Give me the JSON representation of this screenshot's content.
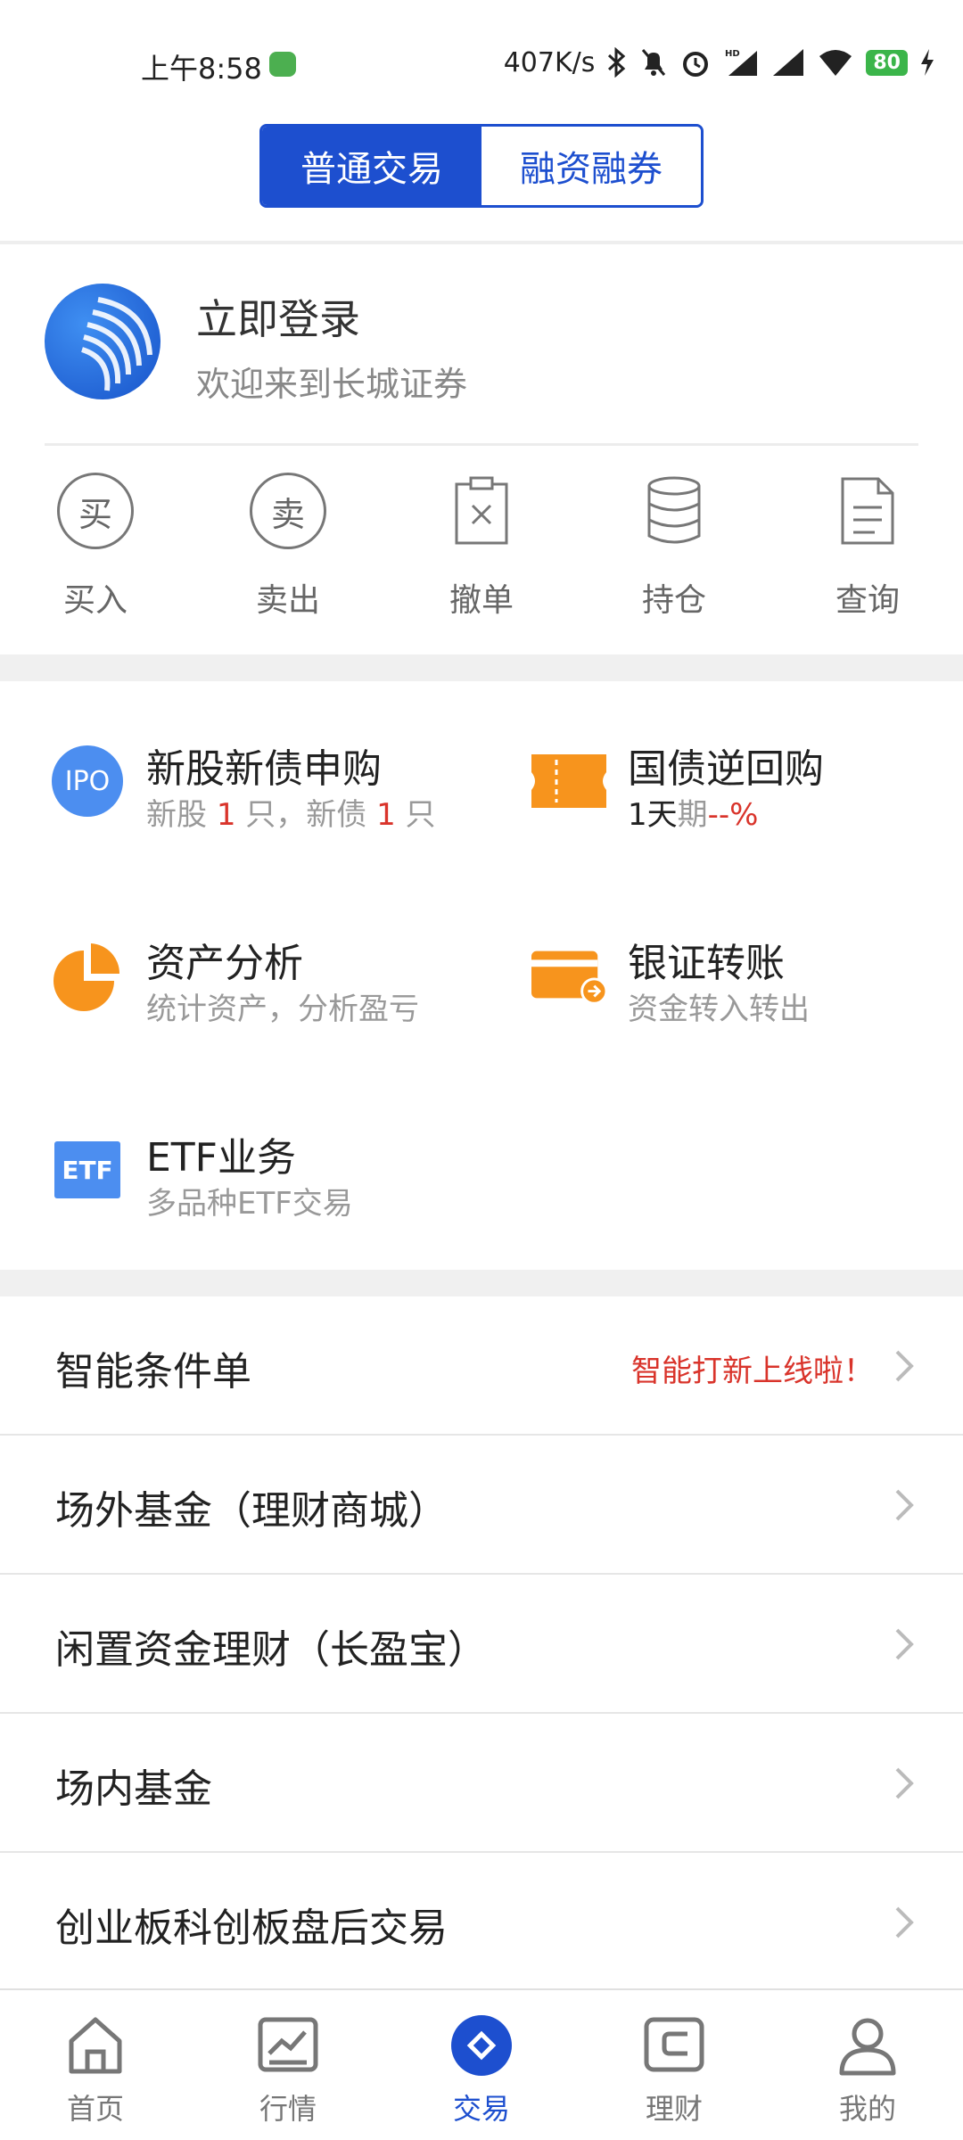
{
  "status_bar": {
    "time": "上午8:58",
    "net_speed": "407K/s",
    "battery": "80"
  },
  "tabs": [
    {
      "label": "普通交易",
      "active": true
    },
    {
      "label": "融资融券",
      "active": false
    }
  ],
  "login": {
    "title": "立即登录",
    "subtitle": "欢迎来到长城证券"
  },
  "quick_actions": [
    {
      "label": "买入",
      "icon": "buy-icon",
      "glyph": "买"
    },
    {
      "label": "卖出",
      "icon": "sell-icon",
      "glyph": "卖"
    },
    {
      "label": "撤单",
      "icon": "cancel-order-icon"
    },
    {
      "label": "持仓",
      "icon": "holdings-icon"
    },
    {
      "label": "查询",
      "icon": "query-icon"
    }
  ],
  "features": {
    "ipo": {
      "title": "新股新债申购",
      "badge": "IPO",
      "sub_a": "新股 ",
      "stock_count": "1",
      "sub_b": " 只，新债 ",
      "bond_count": "1",
      "sub_c": " 只"
    },
    "repo": {
      "title": "国债逆回购",
      "sub_a": "1天",
      "sub_b": "期",
      "rate": "--%"
    },
    "asset": {
      "title": "资产分析",
      "sub": "统计资产，分析盈亏"
    },
    "transfer": {
      "title": "银证转账",
      "sub": "资金转入转出"
    },
    "etf": {
      "title": "ETF业务",
      "badge": "ETF",
      "sub": "多品种ETF交易"
    }
  },
  "list_items": [
    {
      "label": "智能条件单",
      "note": "智能打新上线啦！"
    },
    {
      "label": "场外基金（理财商城）",
      "note": ""
    },
    {
      "label": "闲置资金理财（长盈宝）",
      "note": ""
    },
    {
      "label": "场内基金",
      "note": ""
    },
    {
      "label": "创业板科创板盘后交易",
      "note": ""
    }
  ],
  "bottom_nav": [
    {
      "label": "首页",
      "icon": "home-icon",
      "active": false
    },
    {
      "label": "行情",
      "icon": "market-icon",
      "active": false
    },
    {
      "label": "交易",
      "icon": "trade-icon",
      "active": true
    },
    {
      "label": "理财",
      "icon": "wealth-icon",
      "active": false
    },
    {
      "label": "我的",
      "icon": "profile-icon",
      "active": false
    }
  ],
  "colors": {
    "brand_blue": "#1d4fcf",
    "accent_orange": "#f7941d",
    "alert_red": "#d9342b",
    "ipo_blue": "#4c8ef0"
  }
}
